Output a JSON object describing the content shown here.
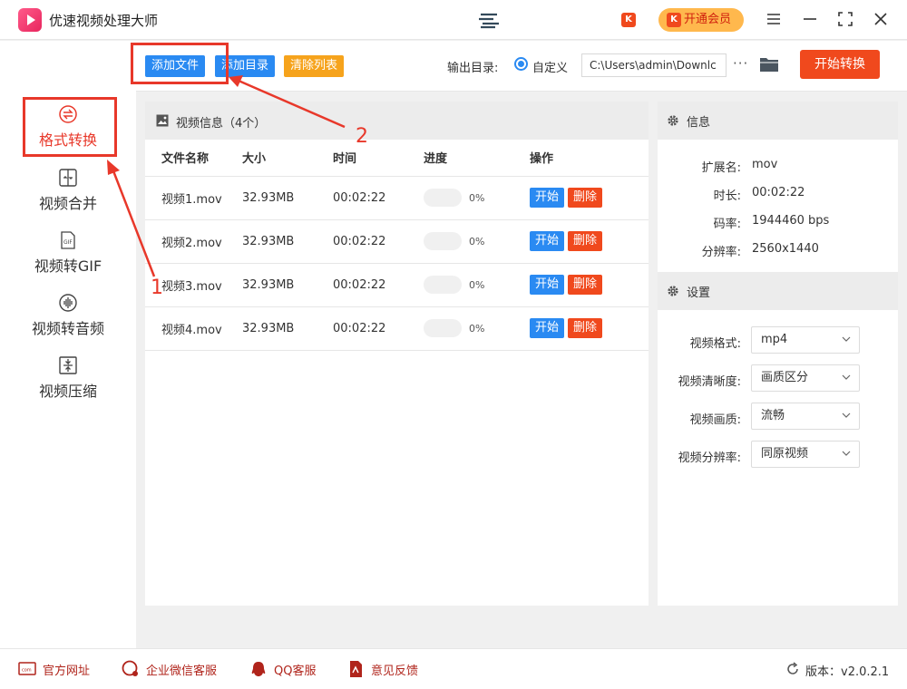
{
  "app": {
    "title": "优速视频处理大师",
    "user_name": " ",
    "vip_label": "开通会员",
    "vip_icon": "K"
  },
  "colors": {
    "accent": "#2a8af2",
    "danger": "#f0491d",
    "warn": "#f6a31c",
    "highlight": "#e8382a"
  },
  "sidebar": {
    "items": [
      {
        "label": "格式转换",
        "icon": "convert-icon",
        "active": true
      },
      {
        "label": "视频合并",
        "icon": "merge-icon"
      },
      {
        "label": "视频转GIF",
        "icon": "gif-icon"
      },
      {
        "label": "视频转音频",
        "icon": "audio-icon"
      },
      {
        "label": "视频压缩",
        "icon": "compress-icon"
      }
    ]
  },
  "toolbar": {
    "add_file": "添加文件",
    "add_dir": "添加目录",
    "clear_list": "清除列表",
    "output_label": "输出目录:",
    "radio_label": "自定义",
    "output_path": "C:\\Users\\admin\\Downlc",
    "more": "···",
    "start_convert": "开始转换"
  },
  "video_panel": {
    "title": "视频信息（4个）",
    "columns": [
      "文件名称",
      "大小",
      "时间",
      "进度",
      "操作"
    ],
    "start_label": "开始",
    "delete_label": "删除",
    "rows": [
      {
        "name": "视频1.mov",
        "size": "32.93MB",
        "time": "00:02:22",
        "progress": "0%"
      },
      {
        "name": "视频2.mov",
        "size": "32.93MB",
        "time": "00:02:22",
        "progress": "0%"
      },
      {
        "name": "视频3.mov",
        "size": "32.93MB",
        "time": "00:02:22",
        "progress": "0%"
      },
      {
        "name": "视频4.mov",
        "size": "32.93MB",
        "time": "00:02:22",
        "progress": "0%"
      }
    ]
  },
  "info_panel": {
    "title": "信息",
    "items": [
      {
        "key": "扩展名:",
        "value": "mov"
      },
      {
        "key": "时长:",
        "value": "00:02:22"
      },
      {
        "key": "码率:",
        "value": "1944460 bps"
      },
      {
        "key": "分辨率:",
        "value": "2560x1440"
      }
    ]
  },
  "settings_panel": {
    "title": "设置",
    "items": [
      {
        "key": "视频格式:",
        "value": "mp4"
      },
      {
        "key": "视频清晰度:",
        "value": "画质区分"
      },
      {
        "key": "视频画质:",
        "value": "流畅"
      },
      {
        "key": "视频分辨率:",
        "value": "同原视频"
      }
    ]
  },
  "statusbar": {
    "website": "官方网址",
    "wechat": "企业微信客服",
    "qq": "QQ客服",
    "feedback": "意见反馈",
    "version": "版本：v2.0.2.1"
  },
  "annotations": {
    "one": "1",
    "two": "2"
  }
}
